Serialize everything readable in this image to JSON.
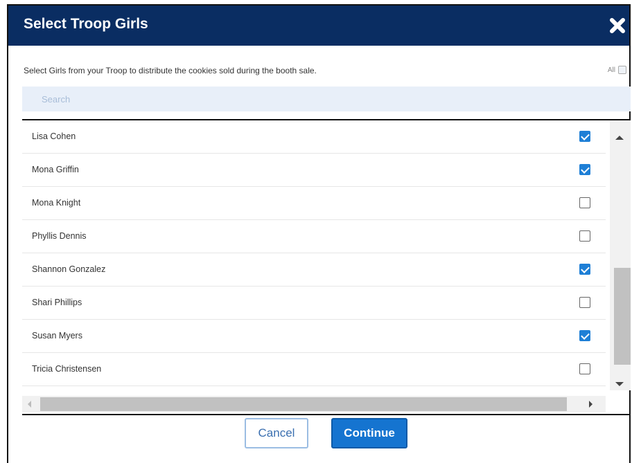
{
  "dialog": {
    "title": "Select Troop Girls",
    "close_icon": "close-x-icon"
  },
  "instruction": "Select Girls from your Troop to distribute the cookies sold during the booth sale.",
  "select_all": {
    "label": "All",
    "checked": false
  },
  "search": {
    "placeholder": "Search",
    "value": ""
  },
  "girls": [
    {
      "name": "Lisa Cohen",
      "checked": true
    },
    {
      "name": "Mona Griffin",
      "checked": true
    },
    {
      "name": "Mona Knight",
      "checked": false
    },
    {
      "name": "Phyllis Dennis",
      "checked": false
    },
    {
      "name": "Shannon Gonzalez",
      "checked": true
    },
    {
      "name": "Shari Phillips",
      "checked": false
    },
    {
      "name": "Susan Myers",
      "checked": true
    },
    {
      "name": "Tricia Christensen",
      "checked": false
    }
  ],
  "buttons": {
    "cancel": "Cancel",
    "continue": "Continue"
  },
  "colors": {
    "header_bg": "#0a2d62",
    "accent": "#1574d0",
    "checkbox_checked": "#1e7fd6"
  }
}
